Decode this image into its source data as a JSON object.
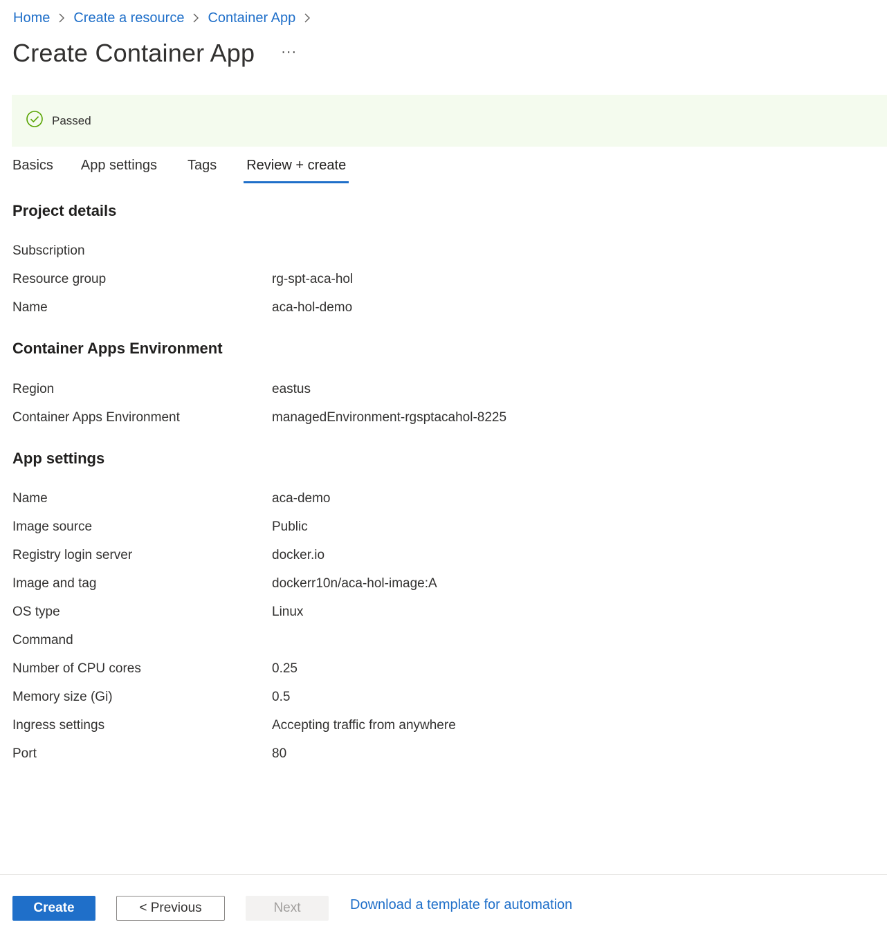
{
  "breadcrumb": {
    "items": [
      "Home",
      "Create a resource",
      "Container App"
    ]
  },
  "header": {
    "title": "Create Container App",
    "more_label": "···"
  },
  "validation": {
    "status": "Passed",
    "icon": "check-circle-icon",
    "color": "#57a300"
  },
  "tabs": [
    "Basics",
    "App settings",
    "Tags",
    "Review + create"
  ],
  "active_tab": "Review + create",
  "sections": {
    "project": {
      "title": "Project details",
      "rows": [
        {
          "label": "Subscription",
          "value": ""
        },
        {
          "label": "Resource group",
          "value": "rg-spt-aca-hol"
        },
        {
          "label": "Name",
          "value": "aca-hol-demo"
        }
      ]
    },
    "environment": {
      "title": "Container Apps Environment",
      "rows": [
        {
          "label": "Region",
          "value": "eastus"
        },
        {
          "label": "Container Apps Environment",
          "value": "managedEnvironment-rgsptacahol-8225"
        }
      ]
    },
    "app": {
      "title": "App settings",
      "rows": [
        {
          "label": "Name",
          "value": "aca-demo"
        },
        {
          "label": "Image source",
          "value": "Public"
        },
        {
          "label": "Registry login server",
          "value": "docker.io"
        },
        {
          "label": "Image and tag",
          "value": "dockerr10n/aca-hol-image:A"
        },
        {
          "label": "OS type",
          "value": "Linux"
        },
        {
          "label": "Command",
          "value": ""
        },
        {
          "label": "Number of CPU cores",
          "value": "0.25"
        },
        {
          "label": "Memory size (Gi)",
          "value": "0.5"
        },
        {
          "label": "Ingress settings",
          "value": "Accepting traffic from anywhere"
        },
        {
          "label": "Port",
          "value": "80"
        }
      ]
    }
  },
  "footer": {
    "create_label": "Create",
    "previous_label": "< Previous",
    "next_label": "Next",
    "template_link": "Download a template for automation"
  },
  "colors": {
    "accent": "#1f6fc9",
    "success_bg": "#f4fbee"
  }
}
